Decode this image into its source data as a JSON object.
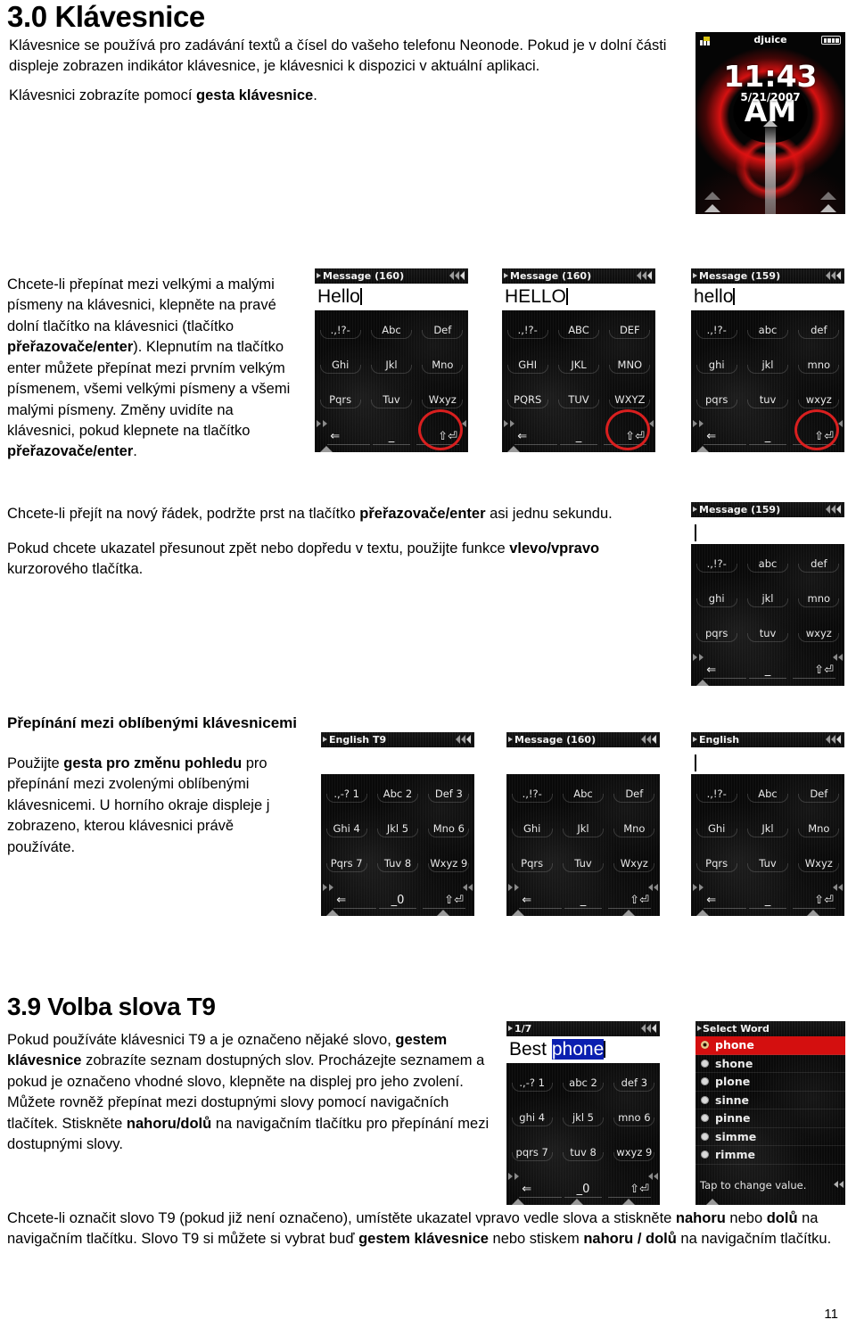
{
  "document": {
    "page_number": "11",
    "section_3_0": {
      "title": "3.0 Klávesnice",
      "para1": "Klávesnice se používá pro zadávání textů a čísel do vašeho telefonu Neonode. Pokud je v dolní části displeje zobrazen indikátor klávesnice, je klávesnici k dispozici v aktuální aplikaci.",
      "para2_prefix": "Klávesnici zobrazíte pomocí ",
      "para2_bold": "gesta klávesnice",
      "para2_suffix": "."
    },
    "case_switch": {
      "p1a": "Chcete-li přepínat mezi velkými a malými písmeny na klávesnici, klepněte na pravé dolní tlačítko na klávesnici (tlačítko ",
      "p1b": "přeřazovače/enter",
      "p1c": "). Klepnutím na tlačítko enter můžete přepínat mezi prvním velkým písmenem, všemi velkými písmeny a všemi malými písmeny. Změny uvidíte na klávesnici, pokud klepnete na tlačítko ",
      "p1d": "přeřazovače/enter",
      "p1e": "."
    },
    "newline_para": {
      "a": "Chcete-li přejít na nový řádek, podržte prst na tlačítko ",
      "b": "přeřazovače/enter",
      "c": " asi jednu sekundu."
    },
    "cursor_para": {
      "a": "Pokud chcete ukazatel přesunout zpět nebo dopředu v textu, použijte funkce ",
      "b": "vlevo/vpravo",
      "c": " kurzorového tlačítka."
    },
    "favorites": {
      "heading": "Přepínání mezi oblíbenými klávesnicemi",
      "a": "Použijte ",
      "b": "gesta pro změnu pohledu",
      "c": " pro přepínání mezi zvolenými oblíbenými klávesnicemi. U horního okraje displeje j zobrazeno, kterou klávesnici právě používáte."
    },
    "section_3_9": {
      "title": "3.9 Volba slova T9",
      "a": "Pokud používáte klávesnici T9 a je označeno nějaké slovo, ",
      "b": "gestem klávesnice",
      "c": " zobrazíte seznam dostupných slov. Procházejte seznamem a pokud je označeno vhodné slovo, klepněte na displej pro jeho zvolení. Můžete rovněž přepínat mezi dostupnými slovy pomocí navigačních tlačítek. Stiskněte ",
      "d": "nahoru/dolů",
      "e": " na navigačním tlačítku pro přepínání mezi dostupnými slovy."
    },
    "footer_para": {
      "a": "Chcete-li označit slovo T9 (pokud již není označeno), umístěte ukazatel vpravo vedle slova a stiskněte ",
      "b": "nahoru",
      "c": " nebo ",
      "d": "dolů",
      "e": " na navigačním tlačítku. Slovo T9 si můžete si vybrat buď ",
      "f": "gestem klávesnice",
      "g": " nebo stiskem ",
      "h": "nahoru / dolů",
      "i": " na navigačním tlačítku."
    }
  },
  "screens": {
    "home": {
      "carrier": "djuice",
      "time": "11:43 AM",
      "date": "5/21/2007",
      "signal_icon": "signal-bars-icon",
      "battery_icon": "battery-full-icon"
    },
    "kb_hello_title": {
      "title": "Message (160)",
      "text": "Hello",
      "keys": [
        ".,!?-",
        "Abc",
        "Def",
        "Ghi",
        "Jkl",
        "Mno",
        "Pqrs",
        "Tuv",
        "Wxyz"
      ],
      "space_label": "_",
      "back_icon": "backspace-arrow-icon",
      "shift_icon": "shift-up-arrow-icon",
      "enter_icon": "enter-return-icon",
      "highlight": true
    },
    "kb_hello_upper": {
      "title": "Message (160)",
      "text": "HELLO",
      "keys": [
        ".,!?-",
        "ABC",
        "DEF",
        "GHI",
        "JKL",
        "MNO",
        "PQRS",
        "TUV",
        "WXYZ"
      ],
      "space_label": "_",
      "highlight": true
    },
    "kb_hello_lower": {
      "title": "Message (159)",
      "text": "hello",
      "keys": [
        ".,!?-",
        "abc",
        "def",
        "ghi",
        "jkl",
        "mno",
        "pqrs",
        "tuv",
        "wxyz"
      ],
      "space_label": "_",
      "highlight": true
    },
    "kb_newline": {
      "title": "Message (159)",
      "text": "",
      "keys": [
        ".,!?-",
        "abc",
        "def",
        "ghi",
        "jkl",
        "mno",
        "pqrs",
        "tuv",
        "wxyz"
      ],
      "space_label": "_",
      "highlight": false
    },
    "kb_english_t9": {
      "title": "English T9",
      "text": "",
      "keys": [
        ".,-? 1",
        "Abc 2",
        "Def 3",
        "Ghi 4",
        "Jkl 5",
        "Mno 6",
        "Pqrs 7",
        "Tuv 8",
        "Wxyz 9"
      ],
      "space_label": "_0",
      "highlight": false
    },
    "kb_message_160": {
      "title": "Message (160)",
      "text": "",
      "keys": [
        ".,!?-",
        "Abc",
        "Def",
        "Ghi",
        "Jkl",
        "Mno",
        "Pqrs",
        "Tuv",
        "Wxyz"
      ],
      "space_label": "_",
      "highlight": false
    },
    "kb_english": {
      "title": "English",
      "text": "",
      "keys": [
        ".,!?-",
        "Abc",
        "Def",
        "Ghi",
        "Jkl",
        "Mno",
        "Pqrs",
        "Tuv",
        "Wxyz"
      ],
      "space_label": "_",
      "highlight": false
    },
    "kb_t9_word": {
      "title": "1/7",
      "text_plain": "Best ",
      "text_highlighted": "phone",
      "keys": [
        ".,-? 1",
        "abc 2",
        "def 3",
        "ghi 4",
        "jkl 5",
        "mno 6",
        "pqrs 7",
        "tuv 8",
        "wxyz 9"
      ],
      "space_label": "_0",
      "highlight": false
    },
    "select_word": {
      "title": "Select Word",
      "footer": "Tap to change value.",
      "options": [
        {
          "label": "phone",
          "selected": true
        },
        {
          "label": "shone",
          "selected": false
        },
        {
          "label": "plone",
          "selected": false
        },
        {
          "label": "sinne",
          "selected": false
        },
        {
          "label": "pinne",
          "selected": false
        },
        {
          "label": "simme",
          "selected": false
        },
        {
          "label": "rimme",
          "selected": false
        }
      ]
    }
  },
  "colors": {
    "selection_red": "#d40f0f",
    "annotation_red": "#d81f1f",
    "text_highlight_blue": "#0b1fb0"
  }
}
